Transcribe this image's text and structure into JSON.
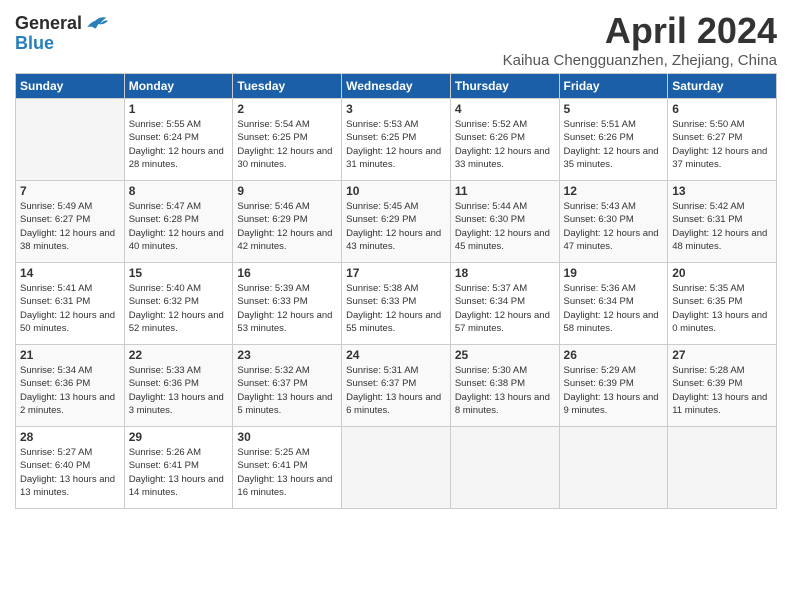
{
  "header": {
    "logo_line1": "General",
    "logo_line2": "Blue",
    "title": "April 2024",
    "subtitle": "Kaihua Chengguanzhen, Zhejiang, China"
  },
  "columns": [
    "Sunday",
    "Monday",
    "Tuesday",
    "Wednesday",
    "Thursday",
    "Friday",
    "Saturday"
  ],
  "weeks": [
    [
      {
        "day": "",
        "sunrise": "",
        "sunset": "",
        "daylight": ""
      },
      {
        "day": "1",
        "sunrise": "Sunrise: 5:55 AM",
        "sunset": "Sunset: 6:24 PM",
        "daylight": "Daylight: 12 hours and 28 minutes."
      },
      {
        "day": "2",
        "sunrise": "Sunrise: 5:54 AM",
        "sunset": "Sunset: 6:25 PM",
        "daylight": "Daylight: 12 hours and 30 minutes."
      },
      {
        "day": "3",
        "sunrise": "Sunrise: 5:53 AM",
        "sunset": "Sunset: 6:25 PM",
        "daylight": "Daylight: 12 hours and 31 minutes."
      },
      {
        "day": "4",
        "sunrise": "Sunrise: 5:52 AM",
        "sunset": "Sunset: 6:26 PM",
        "daylight": "Daylight: 12 hours and 33 minutes."
      },
      {
        "day": "5",
        "sunrise": "Sunrise: 5:51 AM",
        "sunset": "Sunset: 6:26 PM",
        "daylight": "Daylight: 12 hours and 35 minutes."
      },
      {
        "day": "6",
        "sunrise": "Sunrise: 5:50 AM",
        "sunset": "Sunset: 6:27 PM",
        "daylight": "Daylight: 12 hours and 37 minutes."
      }
    ],
    [
      {
        "day": "7",
        "sunrise": "Sunrise: 5:49 AM",
        "sunset": "Sunset: 6:27 PM",
        "daylight": "Daylight: 12 hours and 38 minutes."
      },
      {
        "day": "8",
        "sunrise": "Sunrise: 5:47 AM",
        "sunset": "Sunset: 6:28 PM",
        "daylight": "Daylight: 12 hours and 40 minutes."
      },
      {
        "day": "9",
        "sunrise": "Sunrise: 5:46 AM",
        "sunset": "Sunset: 6:29 PM",
        "daylight": "Daylight: 12 hours and 42 minutes."
      },
      {
        "day": "10",
        "sunrise": "Sunrise: 5:45 AM",
        "sunset": "Sunset: 6:29 PM",
        "daylight": "Daylight: 12 hours and 43 minutes."
      },
      {
        "day": "11",
        "sunrise": "Sunrise: 5:44 AM",
        "sunset": "Sunset: 6:30 PM",
        "daylight": "Daylight: 12 hours and 45 minutes."
      },
      {
        "day": "12",
        "sunrise": "Sunrise: 5:43 AM",
        "sunset": "Sunset: 6:30 PM",
        "daylight": "Daylight: 12 hours and 47 minutes."
      },
      {
        "day": "13",
        "sunrise": "Sunrise: 5:42 AM",
        "sunset": "Sunset: 6:31 PM",
        "daylight": "Daylight: 12 hours and 48 minutes."
      }
    ],
    [
      {
        "day": "14",
        "sunrise": "Sunrise: 5:41 AM",
        "sunset": "Sunset: 6:31 PM",
        "daylight": "Daylight: 12 hours and 50 minutes."
      },
      {
        "day": "15",
        "sunrise": "Sunrise: 5:40 AM",
        "sunset": "Sunset: 6:32 PM",
        "daylight": "Daylight: 12 hours and 52 minutes."
      },
      {
        "day": "16",
        "sunrise": "Sunrise: 5:39 AM",
        "sunset": "Sunset: 6:33 PM",
        "daylight": "Daylight: 12 hours and 53 minutes."
      },
      {
        "day": "17",
        "sunrise": "Sunrise: 5:38 AM",
        "sunset": "Sunset: 6:33 PM",
        "daylight": "Daylight: 12 hours and 55 minutes."
      },
      {
        "day": "18",
        "sunrise": "Sunrise: 5:37 AM",
        "sunset": "Sunset: 6:34 PM",
        "daylight": "Daylight: 12 hours and 57 minutes."
      },
      {
        "day": "19",
        "sunrise": "Sunrise: 5:36 AM",
        "sunset": "Sunset: 6:34 PM",
        "daylight": "Daylight: 12 hours and 58 minutes."
      },
      {
        "day": "20",
        "sunrise": "Sunrise: 5:35 AM",
        "sunset": "Sunset: 6:35 PM",
        "daylight": "Daylight: 13 hours and 0 minutes."
      }
    ],
    [
      {
        "day": "21",
        "sunrise": "Sunrise: 5:34 AM",
        "sunset": "Sunset: 6:36 PM",
        "daylight": "Daylight: 13 hours and 2 minutes."
      },
      {
        "day": "22",
        "sunrise": "Sunrise: 5:33 AM",
        "sunset": "Sunset: 6:36 PM",
        "daylight": "Daylight: 13 hours and 3 minutes."
      },
      {
        "day": "23",
        "sunrise": "Sunrise: 5:32 AM",
        "sunset": "Sunset: 6:37 PM",
        "daylight": "Daylight: 13 hours and 5 minutes."
      },
      {
        "day": "24",
        "sunrise": "Sunrise: 5:31 AM",
        "sunset": "Sunset: 6:37 PM",
        "daylight": "Daylight: 13 hours and 6 minutes."
      },
      {
        "day": "25",
        "sunrise": "Sunrise: 5:30 AM",
        "sunset": "Sunset: 6:38 PM",
        "daylight": "Daylight: 13 hours and 8 minutes."
      },
      {
        "day": "26",
        "sunrise": "Sunrise: 5:29 AM",
        "sunset": "Sunset: 6:39 PM",
        "daylight": "Daylight: 13 hours and 9 minutes."
      },
      {
        "day": "27",
        "sunrise": "Sunrise: 5:28 AM",
        "sunset": "Sunset: 6:39 PM",
        "daylight": "Daylight: 13 hours and 11 minutes."
      }
    ],
    [
      {
        "day": "28",
        "sunrise": "Sunrise: 5:27 AM",
        "sunset": "Sunset: 6:40 PM",
        "daylight": "Daylight: 13 hours and 13 minutes."
      },
      {
        "day": "29",
        "sunrise": "Sunrise: 5:26 AM",
        "sunset": "Sunset: 6:41 PM",
        "daylight": "Daylight: 13 hours and 14 minutes."
      },
      {
        "day": "30",
        "sunrise": "Sunrise: 5:25 AM",
        "sunset": "Sunset: 6:41 PM",
        "daylight": "Daylight: 13 hours and 16 minutes."
      },
      {
        "day": "",
        "sunrise": "",
        "sunset": "",
        "daylight": ""
      },
      {
        "day": "",
        "sunrise": "",
        "sunset": "",
        "daylight": ""
      },
      {
        "day": "",
        "sunrise": "",
        "sunset": "",
        "daylight": ""
      },
      {
        "day": "",
        "sunrise": "",
        "sunset": "",
        "daylight": ""
      }
    ]
  ]
}
